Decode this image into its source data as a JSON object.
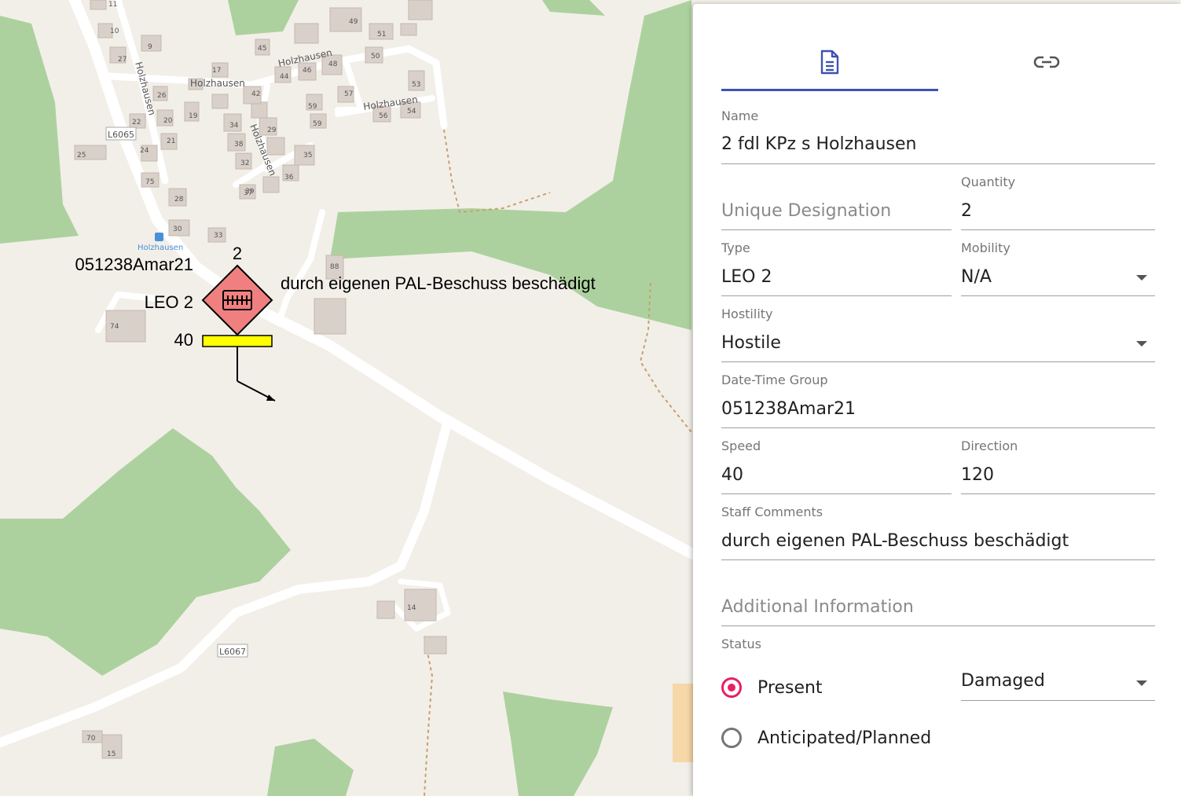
{
  "map": {
    "place_labels": [
      "Holzhausen",
      "Holzhausen",
      "Holzhausen",
      "Holzhausen",
      "Holzhausen"
    ],
    "road_labels": [
      "L6065",
      "L6067"
    ],
    "bus_stop_label": "Holzhausen",
    "house_numbers": [
      "11",
      "10",
      "9",
      "27",
      "17",
      "26",
      "19",
      "20",
      "22",
      "21",
      "24",
      "25",
      "75",
      "28",
      "30",
      "33",
      "34",
      "38",
      "32",
      "37",
      "29",
      "42",
      "44",
      "46",
      "48",
      "57",
      "50",
      "53",
      "59",
      "59",
      "56",
      "54",
      "36",
      "35",
      "45",
      "49",
      "51",
      "74",
      "88",
      "14",
      "15",
      "70",
      "39"
    ]
  },
  "symbol": {
    "quantity": "2",
    "dtg": "051238Amar21",
    "type": "LEO 2",
    "speed": "40",
    "comment": "durch eigenen PAL-Beschuss beschädigt",
    "fill_color": "#f08080",
    "speed_bar_color": "#ffff00",
    "icon": "armour-track-icon"
  },
  "panel": {
    "tabs": [
      {
        "name": "details",
        "icon": "document-icon"
      },
      {
        "name": "links",
        "icon": "link-icon"
      }
    ],
    "accent": "#3f51b5",
    "radio_accent": "#e91e63",
    "name": {
      "label": "Name",
      "value": "2 fdl KPz s Holzhausen"
    },
    "unique_designation": {
      "placeholder": "Unique Designation",
      "value": ""
    },
    "quantity": {
      "label": "Quantity",
      "value": "2"
    },
    "type": {
      "label": "Type",
      "value": "LEO 2"
    },
    "mobility": {
      "label": "Mobility",
      "value": "N/A"
    },
    "hostility": {
      "label": "Hostility",
      "value": "Hostile"
    },
    "dtg": {
      "label": "Date-Time Group",
      "value": "051238Amar21"
    },
    "speed": {
      "label": "Speed",
      "value": "40"
    },
    "direction": {
      "label": "Direction",
      "value": "120"
    },
    "staff_comments": {
      "label": "Staff Comments",
      "value": "durch eigenen PAL-Beschuss beschädigt"
    },
    "additional_information": {
      "placeholder": "Additional Information",
      "value": ""
    },
    "status": {
      "label": "Status",
      "options": [
        {
          "label": "Present",
          "selected": true
        },
        {
          "label": "Anticipated/Planned",
          "selected": false
        }
      ],
      "condition": "Damaged"
    }
  }
}
